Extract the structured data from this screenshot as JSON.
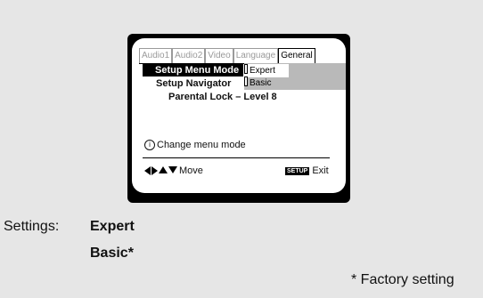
{
  "tabs": [
    "Audio1",
    "Audio2",
    "Video",
    "Language",
    "General"
  ],
  "active_tab": "General",
  "menu": {
    "setup_menu_mode": "Setup Menu Mode",
    "setup_navigator": "Setup Navigator",
    "parental_lock": "Parental Lock – Level 8"
  },
  "options": {
    "expert": "Expert",
    "basic": "Basic"
  },
  "hint": {
    "icon": "i",
    "text": "Change menu mode"
  },
  "nav": {
    "move": "Move",
    "setup_button": "SETUP",
    "exit": "Exit"
  },
  "settings_caption": {
    "label": "Settings:",
    "option1": "Expert",
    "option2": "Basic*"
  },
  "factory_note": "* Factory setting"
}
